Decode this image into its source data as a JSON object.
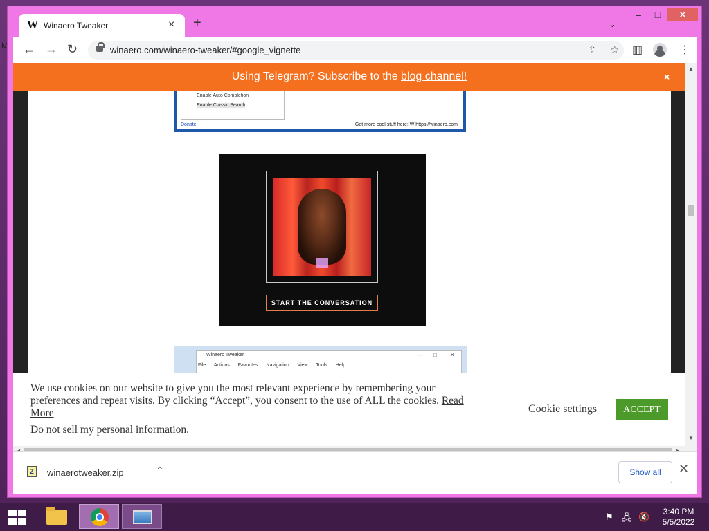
{
  "desktop": {
    "fragment": "M"
  },
  "browser": {
    "tab": {
      "favicon": "W",
      "title": "Winaero Tweaker",
      "close_icon": "×"
    },
    "new_tab_icon": "+",
    "tab_search_icon": "⌄",
    "window_controls": {
      "minimize": "–",
      "maximize": "□",
      "close": "✕"
    },
    "toolbar": {
      "back": "←",
      "forward": "→",
      "reload": "↻",
      "url": "winaero.com/winaero-tweaker/#google_vignette",
      "share_icon": "⇪",
      "star_icon": "☆",
      "side_panel_icon": "▥",
      "menu_icon": "⋮"
    }
  },
  "page": {
    "telegram_bar": {
      "text": "Using Telegram? Subscribe to the ",
      "link": "blog channel!",
      "close": "×"
    },
    "screenshot1": {
      "tree_items": [
        "Enable Auto Completion",
        "Enable Classic Search"
      ],
      "status_left": "Donate!",
      "status_right": "Get more cool stuff here: W https://winaero.com"
    },
    "ad": {
      "cta": "START THE CONVERSATION"
    },
    "screenshot2": {
      "title": "Winaero Tweaker",
      "controls": [
        "—",
        "□",
        "✕"
      ],
      "menu": [
        "File",
        "Actions",
        "Favorites",
        "Navigation",
        "View",
        "Tools",
        "Help"
      ]
    }
  },
  "cookie_banner": {
    "text": "We use cookies on our website to give you the most relevant experience by remembering your preferences and repeat visits. By clicking “Accept”, you consent to the use of ALL the cookies.",
    "read_more": "Read More",
    "do_not_sell": "Do not sell my personal information",
    "period": ".",
    "settings": "Cookie settings",
    "accept": "ACCEPT"
  },
  "scrollbar": {
    "up": "▲",
    "down": "▼",
    "left": "◀",
    "right": "▶"
  },
  "download_bar": {
    "file_icon": "Z",
    "file_name": "winaerotweaker.zip",
    "chevron": "⌃",
    "show_all": "Show all",
    "close": "✕"
  },
  "taskbar": {
    "tray_icons": [
      "⚑",
      "🖧",
      "🔇"
    ],
    "time": "3:40 PM",
    "date": "5/5/2022"
  }
}
